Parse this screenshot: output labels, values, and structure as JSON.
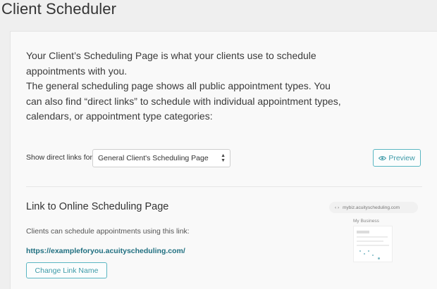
{
  "header": {
    "title": "Client Scheduler"
  },
  "intro": {
    "line1": "Your Client’s Scheduling Page is what your clients use to schedule appointments with you.",
    "line2": "The general scheduling page shows all public appointment types. You can also find “direct links” to schedule with individual appointment types, calendars, or appointment type categories:"
  },
  "direct_links": {
    "label": "Show direct links for:",
    "selected": "General Client's Scheduling Page"
  },
  "toolbar": {
    "preview_label": "Preview",
    "preview_icon": "eye-icon"
  },
  "link_section": {
    "title": "Link to Online Scheduling Page",
    "description": "Clients can schedule appointments using this link:",
    "url": "https://exampleforyou.acuityscheduling.com/",
    "change_button": "Change Link Name"
  },
  "preview_thumbnail": {
    "url_text": "mybiz.acuityscheduling.com",
    "business_name": "My Business"
  },
  "colors": {
    "accent": "#3d9aa8",
    "link": "#1f6f80",
    "background": "#efefef",
    "card": "#f9f9f9"
  }
}
